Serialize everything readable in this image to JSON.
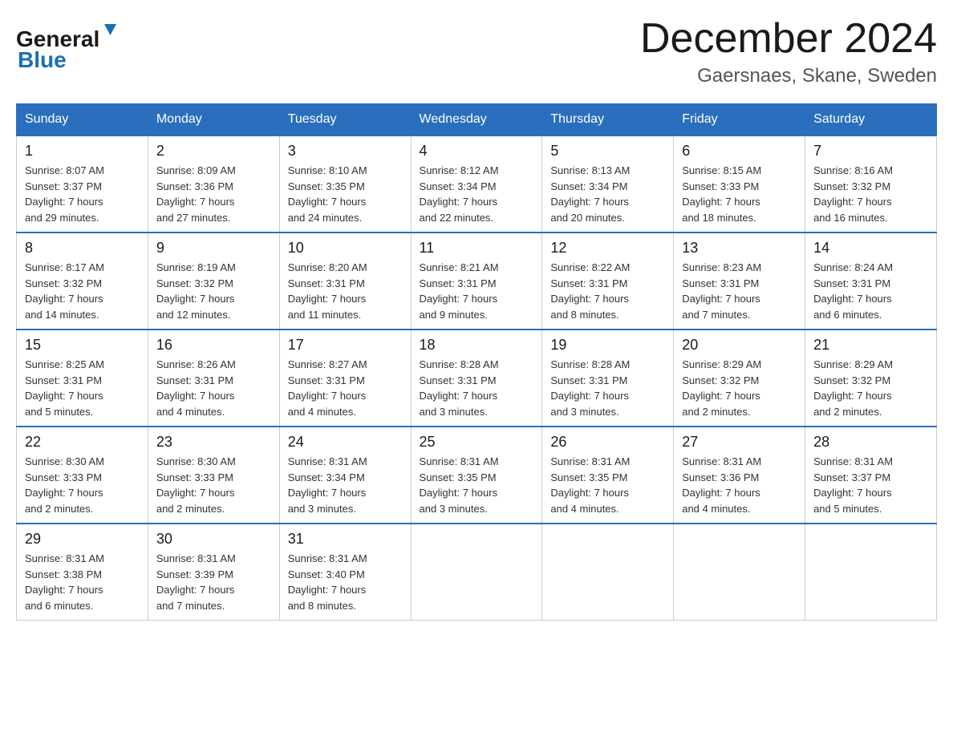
{
  "header": {
    "logo_general": "General",
    "logo_blue": "Blue",
    "month_title": "December 2024",
    "location": "Gaersnaes, Skane, Sweden"
  },
  "weekdays": [
    "Sunday",
    "Monday",
    "Tuesday",
    "Wednesday",
    "Thursday",
    "Friday",
    "Saturday"
  ],
  "weeks": [
    [
      {
        "day": "1",
        "sunrise": "8:07 AM",
        "sunset": "3:37 PM",
        "daylight": "7 hours and 29 minutes."
      },
      {
        "day": "2",
        "sunrise": "8:09 AM",
        "sunset": "3:36 PM",
        "daylight": "7 hours and 27 minutes."
      },
      {
        "day": "3",
        "sunrise": "8:10 AM",
        "sunset": "3:35 PM",
        "daylight": "7 hours and 24 minutes."
      },
      {
        "day": "4",
        "sunrise": "8:12 AM",
        "sunset": "3:34 PM",
        "daylight": "7 hours and 22 minutes."
      },
      {
        "day": "5",
        "sunrise": "8:13 AM",
        "sunset": "3:34 PM",
        "daylight": "7 hours and 20 minutes."
      },
      {
        "day": "6",
        "sunrise": "8:15 AM",
        "sunset": "3:33 PM",
        "daylight": "7 hours and 18 minutes."
      },
      {
        "day": "7",
        "sunrise": "8:16 AM",
        "sunset": "3:32 PM",
        "daylight": "7 hours and 16 minutes."
      }
    ],
    [
      {
        "day": "8",
        "sunrise": "8:17 AM",
        "sunset": "3:32 PM",
        "daylight": "7 hours and 14 minutes."
      },
      {
        "day": "9",
        "sunrise": "8:19 AM",
        "sunset": "3:32 PM",
        "daylight": "7 hours and 12 minutes."
      },
      {
        "day": "10",
        "sunrise": "8:20 AM",
        "sunset": "3:31 PM",
        "daylight": "7 hours and 11 minutes."
      },
      {
        "day": "11",
        "sunrise": "8:21 AM",
        "sunset": "3:31 PM",
        "daylight": "7 hours and 9 minutes."
      },
      {
        "day": "12",
        "sunrise": "8:22 AM",
        "sunset": "3:31 PM",
        "daylight": "7 hours and 8 minutes."
      },
      {
        "day": "13",
        "sunrise": "8:23 AM",
        "sunset": "3:31 PM",
        "daylight": "7 hours and 7 minutes."
      },
      {
        "day": "14",
        "sunrise": "8:24 AM",
        "sunset": "3:31 PM",
        "daylight": "7 hours and 6 minutes."
      }
    ],
    [
      {
        "day": "15",
        "sunrise": "8:25 AM",
        "sunset": "3:31 PM",
        "daylight": "7 hours and 5 minutes."
      },
      {
        "day": "16",
        "sunrise": "8:26 AM",
        "sunset": "3:31 PM",
        "daylight": "7 hours and 4 minutes."
      },
      {
        "day": "17",
        "sunrise": "8:27 AM",
        "sunset": "3:31 PM",
        "daylight": "7 hours and 4 minutes."
      },
      {
        "day": "18",
        "sunrise": "8:28 AM",
        "sunset": "3:31 PM",
        "daylight": "7 hours and 3 minutes."
      },
      {
        "day": "19",
        "sunrise": "8:28 AM",
        "sunset": "3:31 PM",
        "daylight": "7 hours and 3 minutes."
      },
      {
        "day": "20",
        "sunrise": "8:29 AM",
        "sunset": "3:32 PM",
        "daylight": "7 hours and 2 minutes."
      },
      {
        "day": "21",
        "sunrise": "8:29 AM",
        "sunset": "3:32 PM",
        "daylight": "7 hours and 2 minutes."
      }
    ],
    [
      {
        "day": "22",
        "sunrise": "8:30 AM",
        "sunset": "3:33 PM",
        "daylight": "7 hours and 2 minutes."
      },
      {
        "day": "23",
        "sunrise": "8:30 AM",
        "sunset": "3:33 PM",
        "daylight": "7 hours and 2 minutes."
      },
      {
        "day": "24",
        "sunrise": "8:31 AM",
        "sunset": "3:34 PM",
        "daylight": "7 hours and 3 minutes."
      },
      {
        "day": "25",
        "sunrise": "8:31 AM",
        "sunset": "3:35 PM",
        "daylight": "7 hours and 3 minutes."
      },
      {
        "day": "26",
        "sunrise": "8:31 AM",
        "sunset": "3:35 PM",
        "daylight": "7 hours and 4 minutes."
      },
      {
        "day": "27",
        "sunrise": "8:31 AM",
        "sunset": "3:36 PM",
        "daylight": "7 hours and 4 minutes."
      },
      {
        "day": "28",
        "sunrise": "8:31 AM",
        "sunset": "3:37 PM",
        "daylight": "7 hours and 5 minutes."
      }
    ],
    [
      {
        "day": "29",
        "sunrise": "8:31 AM",
        "sunset": "3:38 PM",
        "daylight": "7 hours and 6 minutes."
      },
      {
        "day": "30",
        "sunrise": "8:31 AM",
        "sunset": "3:39 PM",
        "daylight": "7 hours and 7 minutes."
      },
      {
        "day": "31",
        "sunrise": "8:31 AM",
        "sunset": "3:40 PM",
        "daylight": "7 hours and 8 minutes."
      },
      null,
      null,
      null,
      null
    ]
  ]
}
